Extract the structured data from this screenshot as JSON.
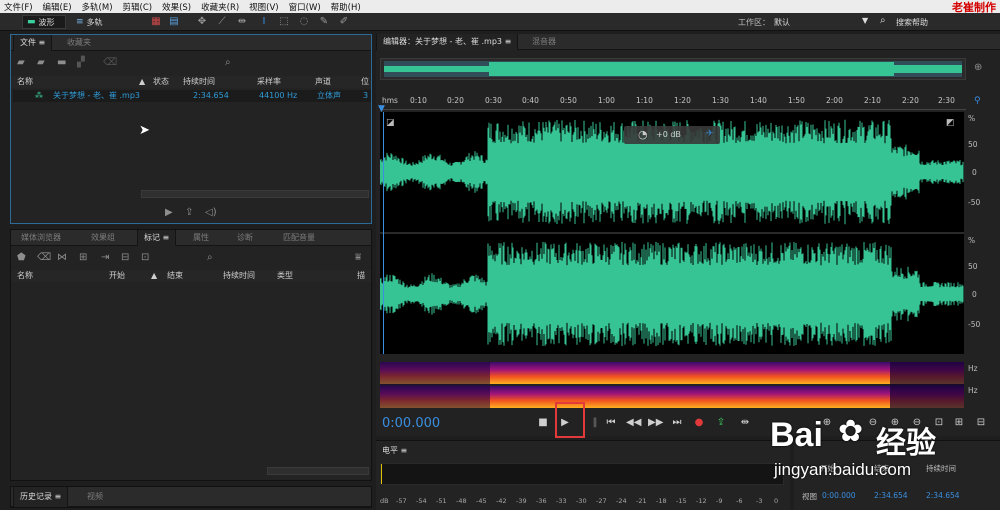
{
  "menu": [
    "文件(F)",
    "编辑(E)",
    "多轨(M)",
    "剪辑(C)",
    "效果(S)",
    "收藏夹(R)",
    "视图(V)",
    "窗口(W)",
    "帮助(H)"
  ],
  "brand": "老崔制作",
  "toolbar": {
    "waveform": "波形",
    "multitrack": "多轨",
    "workspace_label": "工作区：",
    "workspace_value": "默认",
    "search_help": "搜索帮助"
  },
  "files_panel": {
    "tabs": [
      "文件",
      "收藏夹"
    ],
    "columns": [
      "名称",
      "状态",
      "持续时间",
      "采样率",
      "声道",
      "位"
    ],
    "rows": [
      {
        "name": "关于梦想 - 老、崔 .mp3",
        "duration": "2:34.654",
        "sample_rate": "44100 Hz",
        "channels": "立体声",
        "bits": "3"
      }
    ]
  },
  "markers_panel": {
    "tabs": [
      "媒体浏览器",
      "效果组",
      "标记",
      "属性",
      "诊断",
      "匹配音量"
    ],
    "columns": [
      "名称",
      "开始",
      "结束",
      "持续时间",
      "类型",
      "描"
    ]
  },
  "history_panel": {
    "tabs": [
      "历史记录",
      "视频"
    ]
  },
  "editor": {
    "tab": "编辑器：关于梦想 - 老、崔 .mp3",
    "mixer_tab": "混音器",
    "ruler": [
      "hms",
      "0:10",
      "0:20",
      "0:30",
      "0:40",
      "0:50",
      "1:00",
      "1:10",
      "1:20",
      "1:30",
      "1:40",
      "1:50",
      "2:00",
      "2:10",
      "2:20",
      "2:30"
    ],
    "db_ticks": [
      "%",
      "50",
      "0",
      "-50",
      "%",
      "50",
      "0",
      "-50"
    ],
    "hz_ticks": [
      "Hz",
      "Hz"
    ],
    "hud": "+0 dB",
    "time": "0:00.000"
  },
  "levels": {
    "title": "电平",
    "scale": [
      "dB",
      "-57",
      "-54",
      "-51",
      "-48",
      "-45",
      "-42",
      "-39",
      "-36",
      "-33",
      "-30",
      "-27",
      "-24",
      "-21",
      "-18",
      "-15",
      "-12",
      "-9",
      "-6",
      "-3",
      "0"
    ]
  },
  "selection_panel": {
    "start_label": "开始",
    "end_label": "结束",
    "duration_label": "持续时间",
    "view_label": "视图",
    "view_start": "0:00.000",
    "view_end": "2:34.654",
    "view_duration": "2:34.654"
  },
  "watermark": {
    "brand": "Bai",
    "brand2": "经验",
    "url": "jingyan.baidu.com"
  },
  "colors": {
    "accent": "#2f9bd8",
    "wave": "#37c494",
    "highlight": "#e23a3a",
    "playhead": "#3a8fe0"
  }
}
